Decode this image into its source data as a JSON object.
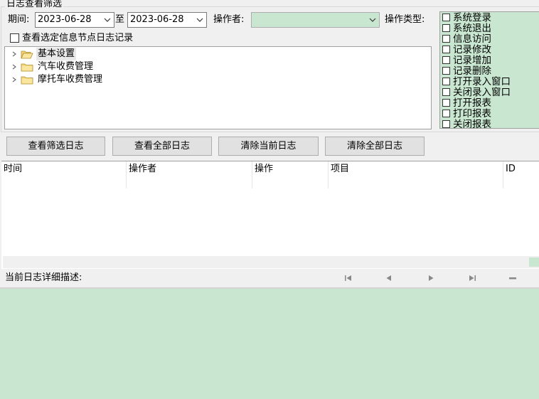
{
  "filter": {
    "group_title": "日志查看筛选",
    "period_label": "期间:",
    "date_from": "2023-06-28",
    "to_label": "至",
    "date_to": "2023-06-28",
    "operator_label": "操作者:",
    "operator_value": "",
    "optype_label": "操作类型:",
    "selected_node_checkbox_label": "查看选定信息节点日志记录",
    "tree": [
      {
        "label": "基本设置",
        "icon": "folder-open-icon",
        "selected": true
      },
      {
        "label": "汽车收费管理",
        "icon": "folder-icon",
        "selected": false
      },
      {
        "label": "摩托车收费管理",
        "icon": "folder-icon",
        "selected": false
      }
    ],
    "operation_types": [
      "系统登录",
      "系统退出",
      "信息访问",
      "记录修改",
      "记录增加",
      "记录删除",
      "打开录入窗口",
      "关闭录入窗口",
      "打开报表",
      "打印报表",
      "关闭报表"
    ]
  },
  "buttons": {
    "view_filtered": "查看筛选日志",
    "view_all": "查看全部日志",
    "clear_current": "清除当前日志",
    "clear_all": "清除全部日志"
  },
  "log_table": {
    "columns": [
      "时间",
      "操作者",
      "操作",
      "项目",
      "ID"
    ],
    "rows": []
  },
  "detail": {
    "label": "当前日志详细描述:",
    "nav_icons": [
      "first-record-icon",
      "prev-record-icon",
      "next-record-icon",
      "last-record-icon",
      "delete-record-icon"
    ]
  },
  "colors": {
    "panel_green": "#c9e7d0",
    "background": "#f0f0f0"
  }
}
